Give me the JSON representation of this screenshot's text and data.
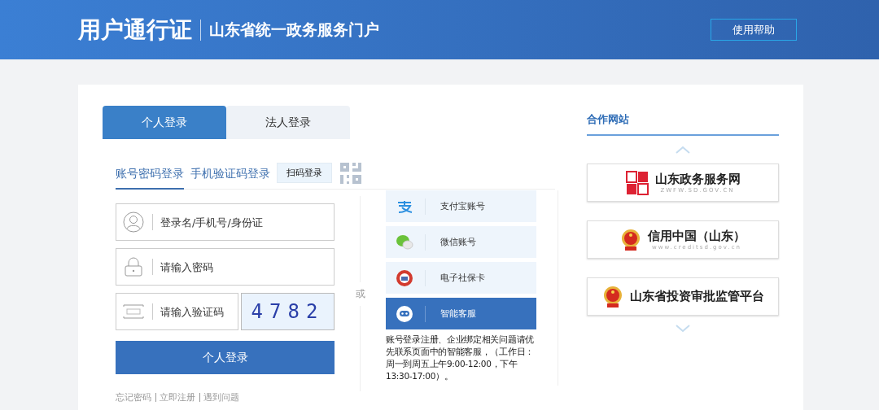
{
  "header": {
    "title": "用户通行证",
    "subtitle": "山东省统一政务服务门户",
    "help_button": "使用帮助"
  },
  "login_tabs": [
    {
      "label": "个人登录",
      "selected": true
    },
    {
      "label": "法人登录",
      "selected": false
    }
  ],
  "login_methods": [
    {
      "label": "账号密码登录",
      "selected": true,
      "kind": "link"
    },
    {
      "label": "手机验证码登录",
      "selected": false,
      "kind": "link"
    },
    {
      "label": "扫码登录",
      "selected": false,
      "kind": "qr"
    }
  ],
  "fields": [
    {
      "kind": "user",
      "placeholder": "登录名/手机号/身份证"
    },
    {
      "kind": "lock",
      "placeholder": "请输入密码"
    },
    {
      "kind": "code",
      "placeholder": "请输入验证码"
    }
  ],
  "captcha": "4782",
  "submit_button": "个人登录",
  "footer_links": [
    "忘记密码",
    "立即注册",
    "遇到问题"
  ],
  "or_label": "或",
  "alt_logins": [
    {
      "kind": "alipay",
      "label": "支付宝账号",
      "selected": false
    },
    {
      "kind": "wechat",
      "label": "微信账号",
      "selected": false
    },
    {
      "kind": "social",
      "label": "电子社保卡",
      "selected": false
    },
    {
      "kind": "service",
      "label": "智能客服",
      "selected": true
    }
  ],
  "help_text": "账号登录注册、企业绑定相关问题请优先联系页面中的智能客服，（工作日：周一到周五上午9:00-12:00，下午13:30-17:00）。",
  "partners": {
    "title": "合作网站",
    "items": [
      {
        "kind": "seal",
        "name": "山东政务服务网",
        "url": "ZWFW.SD.GOV.CN"
      },
      {
        "kind": "emblem",
        "name": "信用中国（山东）",
        "url": "www.creditsd.gov.cn"
      },
      {
        "kind": "emblem",
        "name": "山东省投资审批监管平台"
      }
    ]
  }
}
